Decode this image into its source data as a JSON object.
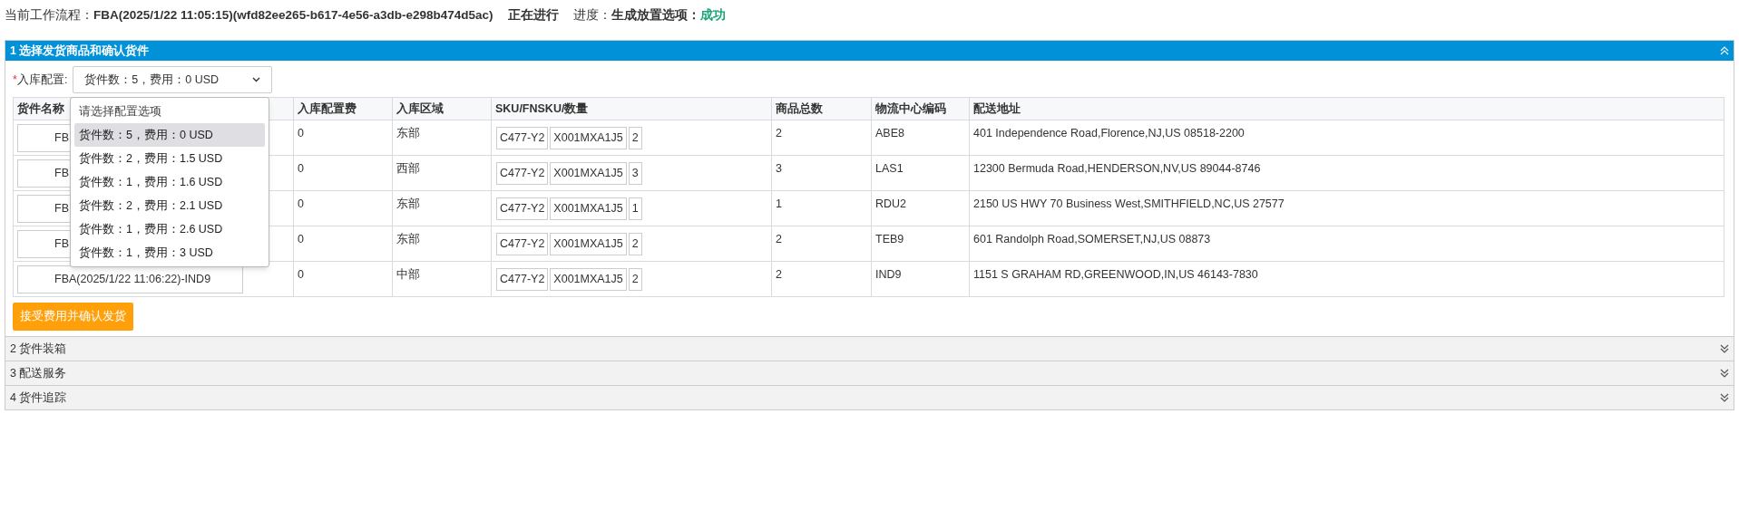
{
  "workflow": {
    "label": "当前工作流程：",
    "name": "FBA(2025/1/22 11:05:15)(wfd82ee265-b617-4e56-a3db-e298b474d5ac)",
    "status": "正在进行",
    "progress_label": "进度：",
    "step": "生成放置选项：",
    "result": "成功"
  },
  "sections": [
    {
      "title": "1 选择发货商品和确认货件",
      "expanded": true
    },
    {
      "title": "2 货件装箱",
      "expanded": false
    },
    {
      "title": "3 配送服务",
      "expanded": false
    },
    {
      "title": "4 货件追踪",
      "expanded": false
    }
  ],
  "config": {
    "required_mark": "*",
    "label": "入库配置:",
    "value": "货件数：5，费用：0 USD",
    "open": true,
    "options": [
      {
        "kind": "placeholder",
        "label": "请选择配置选项",
        "selected": false
      },
      {
        "kind": "option",
        "label": "货件数：5，费用：0 USD",
        "selected": true
      },
      {
        "kind": "option",
        "label": "货件数：2，费用：1.5 USD",
        "selected": false
      },
      {
        "kind": "option",
        "label": "货件数：1，费用：1.6 USD",
        "selected": false
      },
      {
        "kind": "option",
        "label": "货件数：2，费用：2.1 USD",
        "selected": false
      },
      {
        "kind": "option",
        "label": "货件数：1，费用：2.6 USD",
        "selected": false
      },
      {
        "kind": "option",
        "label": "货件数：1，费用：3 USD",
        "selected": false
      }
    ]
  },
  "table": {
    "columns": [
      "货件名称",
      "入库配置费",
      "入库区域",
      "SKU/FNSKU/数量",
      "商品总数",
      "物流中心编码",
      "配送地址"
    ],
    "rows": [
      {
        "name": "FB",
        "fee": "0",
        "region": "东部",
        "sku": "C477-Y2",
        "fnsku": "X001MXA1J5",
        "qty": "2",
        "total": "2",
        "center": "ABE8",
        "address": "401 Independence Road,Florence,NJ,US 08518-2200"
      },
      {
        "name": "FB",
        "fee": "0",
        "region": "西部",
        "sku": "C477-Y2",
        "fnsku": "X001MXA1J5",
        "qty": "3",
        "total": "3",
        "center": "LAS1",
        "address": "12300 Bermuda Road,HENDERSON,NV,US 89044-8746"
      },
      {
        "name": "FB",
        "fee": "0",
        "region": "东部",
        "sku": "C477-Y2",
        "fnsku": "X001MXA1J5",
        "qty": "1",
        "total": "1",
        "center": "RDU2",
        "address": "2150 US HWY 70 Business West,SMITHFIELD,NC,US 27577"
      },
      {
        "name": "FB",
        "fee": "0",
        "region": "东部",
        "sku": "C477-Y2",
        "fnsku": "X001MXA1J5",
        "qty": "2",
        "total": "2",
        "center": "TEB9",
        "address": "601 Randolph Road,SOMERSET,NJ,US 08873"
      },
      {
        "name": "FBA(2025/1/22 11:06:22)-IND9",
        "fee": "0",
        "region": "中部",
        "sku": "C477-Y2",
        "fnsku": "X001MXA1J5",
        "qty": "2",
        "total": "2",
        "center": "IND9",
        "address": "1151 S GRAHAM RD,GREENWOOD,IN,US 46143-7830"
      }
    ]
  },
  "accept_button": "接受费用并确认发货"
}
